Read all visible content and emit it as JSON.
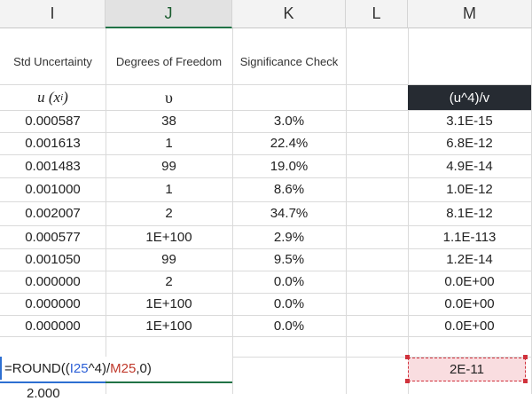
{
  "columns": [
    "I",
    "J",
    "K",
    "L",
    "M"
  ],
  "headers": {
    "std_uncertainty": "Std Uncertainty",
    "degrees_of_freedom": "Degrees of Freedom",
    "significance_check": "Significance Check"
  },
  "symbols": {
    "u_base": "u",
    "u_open": "(x",
    "u_sub": "i",
    "u_close": ")",
    "nu": "υ",
    "m_header": "(u^4)/v"
  },
  "rows": [
    {
      "u": "0.000587",
      "dof": "38",
      "sig": "3.0%",
      "m": "3.1E-15"
    },
    {
      "u": "0.001613",
      "dof": "1",
      "sig": "22.4%",
      "m": "6.8E-12"
    },
    {
      "u": "0.001483",
      "dof": "99",
      "sig": "19.0%",
      "m": "4.9E-14"
    },
    {
      "u": "0.001000",
      "dof": "1",
      "sig": "8.6%",
      "m": "1.0E-12"
    },
    {
      "u": "0.002007",
      "dof": "2",
      "sig": "34.7%",
      "m": "8.1E-12"
    },
    {
      "u": "0.000577",
      "dof": "1E+100",
      "sig": "2.9%",
      "m": "1.1E-113"
    },
    {
      "u": "0.001050",
      "dof": "99",
      "sig": "9.5%",
      "m": "1.2E-14"
    },
    {
      "u": "0.000000",
      "dof": "2",
      "sig": "0.0%",
      "m": "0.0E+00"
    },
    {
      "u": "0.000000",
      "dof": "1E+100",
      "sig": "0.0%",
      "m": "0.0E+00"
    },
    {
      "u": "0.000000",
      "dof": "1E+100",
      "sig": "0.0%",
      "m": "0.0E+00"
    }
  ],
  "formula": {
    "prefix": "=ROUND((",
    "ref1": "I25",
    "mid": "^4)/",
    "ref2": "M25",
    "suffix": ",0)"
  },
  "result": "2E-11",
  "peek_value": "2.000",
  "colors": {
    "selected_column": "#217346",
    "dark_header": "#262b32",
    "ref_blue": "#2a5ed6",
    "ref_red": "#c0392b"
  }
}
